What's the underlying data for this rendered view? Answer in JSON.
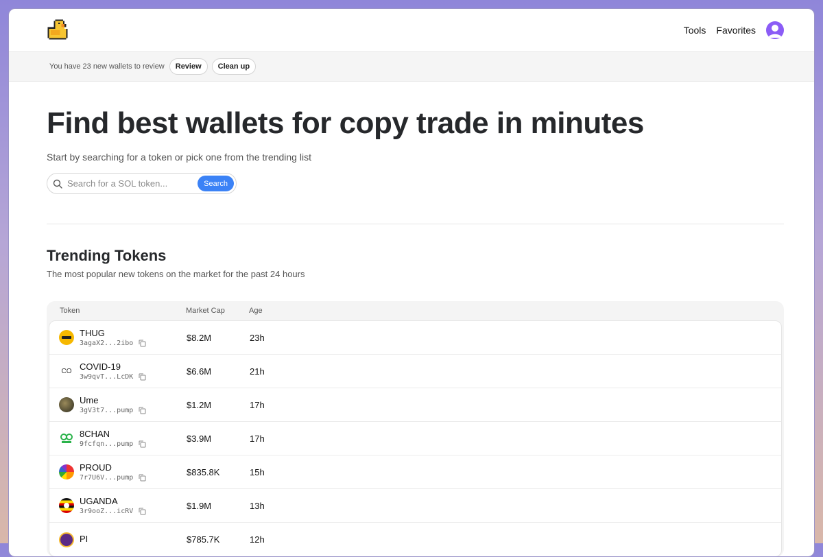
{
  "header": {
    "nav": [
      "Tools",
      "Favorites"
    ]
  },
  "banner": {
    "text": "You have 23 new wallets to review",
    "review_label": "Review",
    "cleanup_label": "Clean up"
  },
  "hero": {
    "title": "Find best wallets for copy trade in minutes",
    "subtitle": "Start by searching for a token or pick one from the trending list"
  },
  "search": {
    "placeholder": "Search for a SOL token...",
    "button_label": "Search"
  },
  "trending": {
    "title": "Trending Tokens",
    "subtitle": "The most popular new tokens on the market for the past 24 hours",
    "columns": [
      "Token",
      "Market Cap",
      "Age"
    ],
    "rows": [
      {
        "name": "THUG",
        "address": "3agaX2...2ibo",
        "market_cap": "$8.2M",
        "age": "23h",
        "icon": "thug-logo-icon",
        "icon_text": ""
      },
      {
        "name": "COVID-19",
        "address": "3w9qvT...LcDK",
        "market_cap": "$6.6M",
        "age": "21h",
        "icon": "text-icon",
        "icon_text": "CO"
      },
      {
        "name": "Ume",
        "address": "3gV3t7...pump",
        "market_cap": "$1.2M",
        "age": "17h",
        "icon": "ume-logo-icon",
        "icon_text": ""
      },
      {
        "name": "8CHAN",
        "address": "9fcfqn...pump",
        "market_cap": "$3.9M",
        "age": "17h",
        "icon": "8chan-logo-icon",
        "icon_text": ""
      },
      {
        "name": "PROUD",
        "address": "7r7U6V...pump",
        "market_cap": "$835.8K",
        "age": "15h",
        "icon": "proud-logo-icon",
        "icon_text": ""
      },
      {
        "name": "UGANDA",
        "address": "3r9ooZ...icRV",
        "market_cap": "$1.9M",
        "age": "13h",
        "icon": "uganda-flag-icon",
        "icon_text": ""
      },
      {
        "name": "PI",
        "address": "",
        "market_cap": "$785.7K",
        "age": "12h",
        "icon": "pi-logo-icon",
        "icon_text": ""
      }
    ]
  },
  "colors": {
    "accent": "#3b82f6",
    "avatar": "#8b5cf6"
  }
}
